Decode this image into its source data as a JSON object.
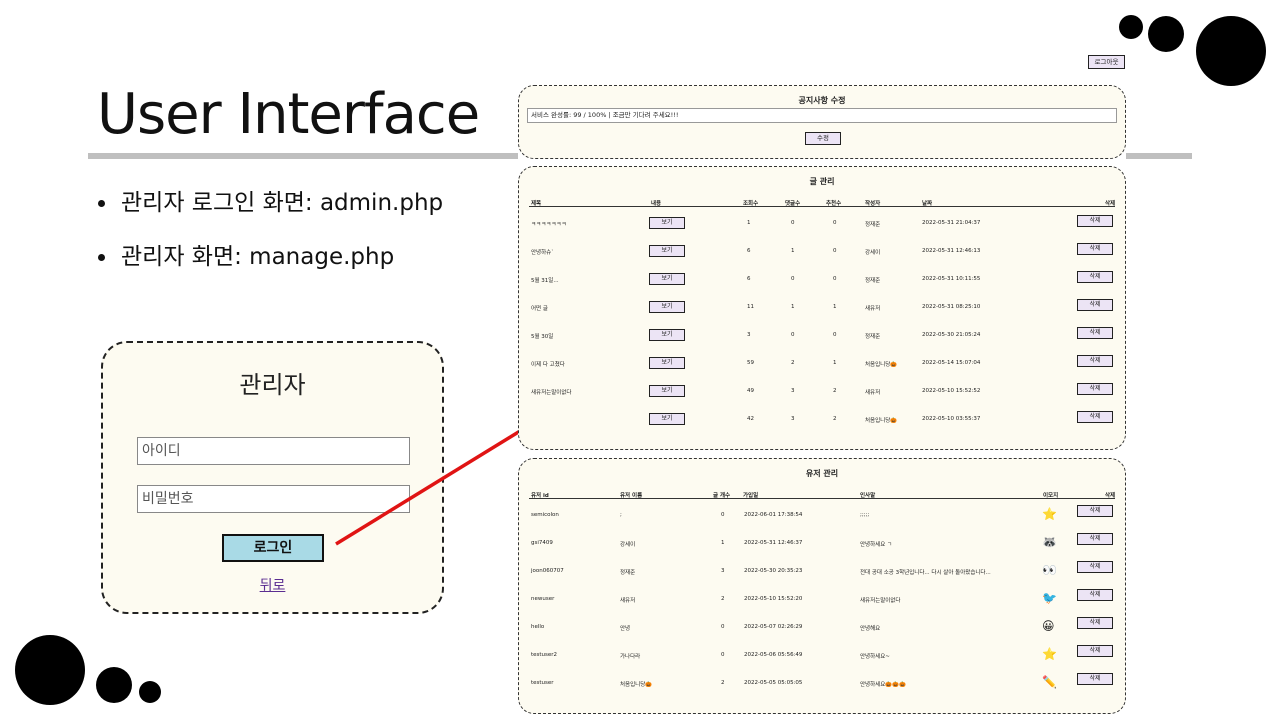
{
  "slide": {
    "title": "User Interface",
    "bullets": [
      "관리자 로그인 화면: admin.php",
      "관리자 화면: manage.php"
    ]
  },
  "login": {
    "title": "관리자",
    "id_placeholder": "아이디",
    "pw_placeholder": "비밀번호",
    "login_button": "로그인",
    "back_link": "뒤로"
  },
  "admin": {
    "logout_button": "로그아웃",
    "notice": {
      "title": "공지사항 수정",
      "value": "서비스 완성률: 99 / 100% | 조금만 기다려 주세요!!!",
      "submit": "수정"
    },
    "posts": {
      "title": "글 관리",
      "headers": [
        "제목",
        "내용",
        "조회수",
        "댓글수",
        "추천수",
        "작성자",
        "날짜",
        "삭제"
      ],
      "view_label": "보기",
      "delete_label": "삭제",
      "rows": [
        {
          "title": "ㅋㅋㅋㅋㅋㅋㅋ",
          "views": "1",
          "comments": "0",
          "likes": "0",
          "author": "정재준",
          "date": "2022-05-31 21:04:37"
        },
        {
          "title": "안녕하슈`",
          "views": "6",
          "comments": "1",
          "likes": "0",
          "author": "강세이",
          "date": "2022-05-31 12:46:13"
        },
        {
          "title": "5월 31일...",
          "views": "6",
          "comments": "0",
          "likes": "0",
          "author": "정재준",
          "date": "2022-05-31 10:11:55"
        },
        {
          "title": "어떤 글",
          "views": "11",
          "comments": "1",
          "likes": "1",
          "author": "새유저",
          "date": "2022-05-31 08:25:10"
        },
        {
          "title": "5월 30일",
          "views": "3",
          "comments": "0",
          "likes": "0",
          "author": "정재준",
          "date": "2022-05-30 21:05:24"
        },
        {
          "title": "이제 다 고쳤다",
          "views": "59",
          "comments": "2",
          "likes": "1",
          "author": "처음입니당🎃",
          "date": "2022-05-14 15:07:04"
        },
        {
          "title": "새유저는말이없다",
          "views": "49",
          "comments": "3",
          "likes": "2",
          "author": "새유저",
          "date": "2022-05-10 15:52:52"
        },
        {
          "title": "",
          "views": "42",
          "comments": "3",
          "likes": "2",
          "author": "처음입니당🎃",
          "date": "2022-05-10 03:55:37"
        }
      ]
    },
    "users": {
      "title": "유저 관리",
      "headers": [
        "유저 id",
        "유저 이름",
        "글 개수",
        "가입일",
        "인사말",
        "이모지",
        "삭제"
      ],
      "delete_label": "삭제",
      "rows": [
        {
          "id": "semicolon",
          "name": ";",
          "posts": "0",
          "joined": "2022-06-01 17:38:54",
          "greeting": ";;;;;",
          "emoji": "⭐"
        },
        {
          "id": "gsi7409",
          "name": "강세이",
          "posts": "1",
          "joined": "2022-05-31 12:46:37",
          "greeting": "안녕하세요 ㄱ",
          "emoji": "🦝"
        },
        {
          "id": "joon060707",
          "name": "정재준",
          "posts": "3",
          "joined": "2022-05-30 20:35:23",
          "greeting": "전대 공대 소공 3학년입니다... 다시 살아 돌아왔습니다...",
          "emoji": "👀"
        },
        {
          "id": "newuser",
          "name": "새유저",
          "posts": "2",
          "joined": "2022-05-10 15:52:20",
          "greeting": "새유저는말이없다",
          "emoji": "🐦"
        },
        {
          "id": "hello",
          "name": "안녕",
          "posts": "0",
          "joined": "2022-05-07 02:26:29",
          "greeting": "안녕해요",
          "emoji": "😀"
        },
        {
          "id": "testuser2",
          "name": "가나다라",
          "posts": "0",
          "joined": "2022-05-06 05:56:49",
          "greeting": "안녕하세요~",
          "emoji": "⭐"
        },
        {
          "id": "testuser",
          "name": "처음입니당🎃",
          "posts": "2",
          "joined": "2022-05-05 05:05:05",
          "greeting": "안녕하세요🎃🎃🎃",
          "emoji": "✏️"
        }
      ]
    }
  }
}
